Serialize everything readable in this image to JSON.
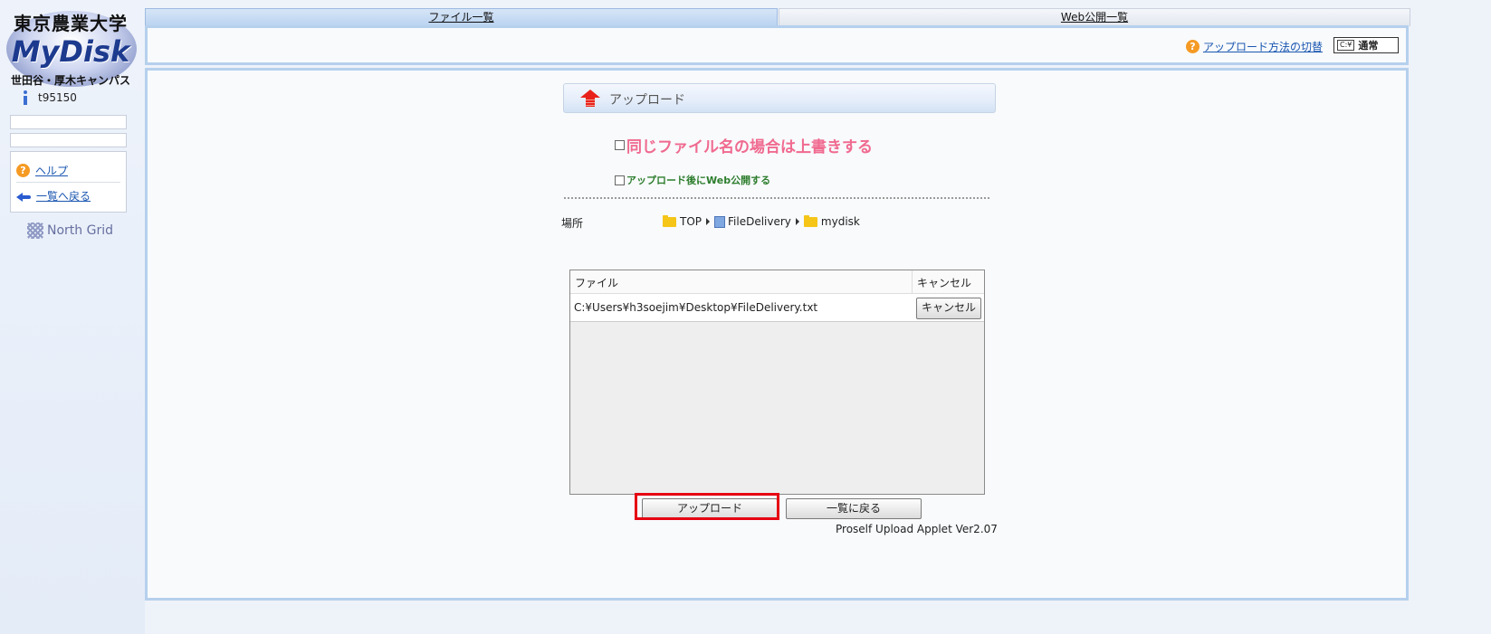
{
  "sidebar": {
    "logo_kanji": "東京農業大学",
    "logo_brand": "MyDisk",
    "logo_campus": "世田谷・厚木キャンパス",
    "user": "t95150",
    "help_link": "ヘルプ",
    "back_link": "一覧へ戻る",
    "footer_brand": "North Grid"
  },
  "tabs": {
    "files": "ファイル一覧",
    "web": "Web公開一覧"
  },
  "topbar": {
    "switch_link": "アップロード方法の切替",
    "mode_icon": "C:¥",
    "mode_label": "通常"
  },
  "upload": {
    "title": "アップロード",
    "overwrite_label": "同じファイル名の場合は上書きする",
    "overwrite_checked": false,
    "webpub_label": "アップロード後にWeb公開する",
    "webpub_checked": false,
    "location_label": "場所",
    "path": [
      "TOP",
      "FileDelivery",
      "mydisk"
    ],
    "table": {
      "col_file": "ファイル",
      "col_cancel": "キャンセル",
      "rows": [
        {
          "file": "C:¥Users¥h3soejim¥Desktop¥FileDelivery.txt",
          "cancel": "キャンセル"
        }
      ]
    },
    "upload_button": "アップロード",
    "back_button": "一覧に戻る",
    "version": "Proself Upload Applet Ver2.07"
  },
  "colors": {
    "accent_pink": "#f06a8f",
    "accent_green": "#2d7d2d",
    "highlight_red": "#e60012",
    "frame_blue": "#b5d0ed"
  }
}
